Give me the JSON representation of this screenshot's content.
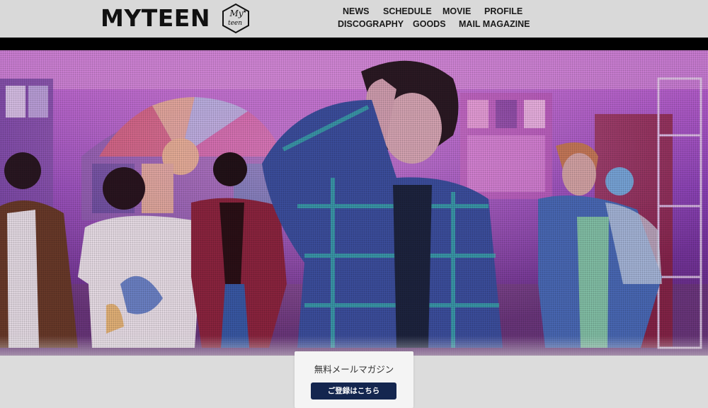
{
  "brand": {
    "logo_text": "MYTEEN",
    "badge_text_1": "My",
    "badge_text_2": "teen"
  },
  "nav": {
    "row1": [
      "NEWS",
      "SCHEDULE",
      "MOVIE",
      "PROFILE"
    ],
    "row2": [
      "DISCOGRAPHY",
      "GOODS",
      "MAIL MAGAZINE"
    ]
  },
  "hero": {
    "description": ""
  },
  "mail_magazine": {
    "title": "無料メールマガジン",
    "button_label": "ご登録はこちら"
  },
  "colors": {
    "header_bg": "#d9d9d9",
    "page_bg": "#dcdcdc",
    "button_bg": "#14264f",
    "hero_tint": "#9b3fd6"
  }
}
